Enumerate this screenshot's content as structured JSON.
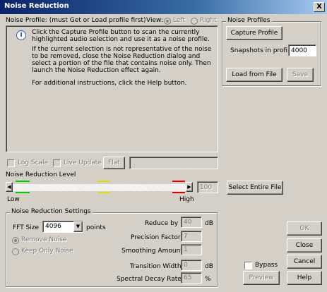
{
  "window": {
    "title": "Noise Reduction",
    "close_glyph": "X"
  },
  "profile": {
    "label": "Noise Profile: (must Get or Load profile first)",
    "view_label": "View:",
    "view_left": "Left",
    "view_right": "Right",
    "info_p1": "Click the Capture Profile button to scan the currently highlighted audio selection and use it as a noise profile.",
    "info_p2": "If the current selection is not representative of the noise to be removed, close the Noise Reduction dialog and select a portion of the file that contains noise only.  Then launch the Noise Reduction effect again.",
    "info_p3": "For additional instructions, click the Help button."
  },
  "noise_profiles": {
    "legend": "Noise Profiles",
    "capture_button": "Capture Profile",
    "snapshots_label": "Snapshots in profile",
    "snapshots_value": "4000",
    "load_button": "Load from File",
    "save_button": "Save"
  },
  "options": {
    "log_scale": "Log Scale",
    "live_update": "Live Update",
    "flat_button": "Flat"
  },
  "level": {
    "label": "Noise Reduction Level",
    "value": "100",
    "low": "Low",
    "high": "High",
    "select_entire_button": "Select Entire File",
    "percent": 1.0,
    "colors": {
      "green": "#00cc00",
      "yellow": "#e0e000",
      "red": "#e00000"
    }
  },
  "settings": {
    "legend": "Noise Reduction Settings",
    "fft_label": "FFT Size",
    "fft_value": "4096",
    "points_label": "points",
    "remove_noise": "Remove Noise",
    "keep_only_noise": "Keep Only Noise",
    "reduce_by_label": "Reduce by",
    "reduce_by_value": "40",
    "reduce_by_unit": "dB",
    "precision_label": "Precision Factor",
    "precision_value": "7",
    "smoothing_label": "Smoothing Amount",
    "smoothing_value": "1",
    "transition_label": "Transition Width",
    "transition_value": "0",
    "transition_unit": "dB",
    "spectral_label": "Spectral Decay Rate",
    "spectral_value": "65",
    "spectral_unit": "%"
  },
  "actions": {
    "ok": "OK",
    "close": "Close",
    "cancel": "Cancel",
    "help": "Help",
    "bypass": "Bypass",
    "preview": "Preview"
  }
}
